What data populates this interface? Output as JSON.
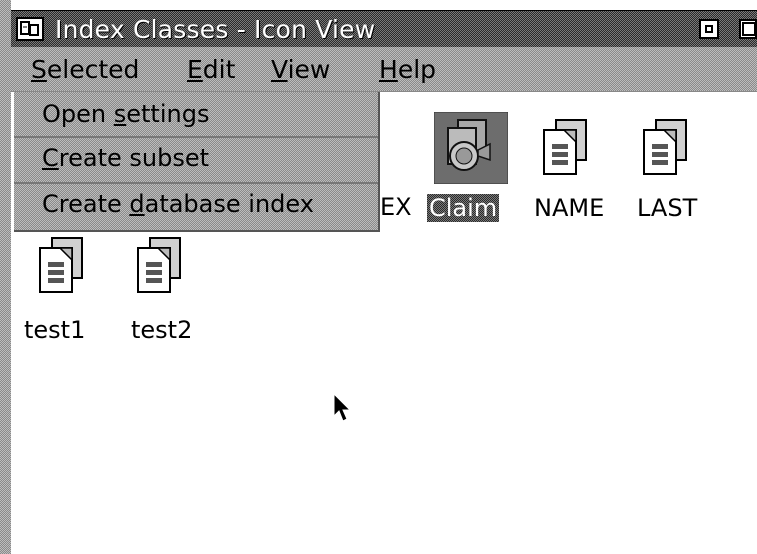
{
  "window": {
    "title": "Index Classes - Icon View"
  },
  "menubar": {
    "items": [
      {
        "label": "Selected",
        "mnemonic": "S",
        "rest": "elected"
      },
      {
        "label": "Edit",
        "mnemonic": "E",
        "rest": "dit"
      },
      {
        "label": "View",
        "mnemonic": "V",
        "rest": "iew"
      },
      {
        "label": "Help",
        "mnemonic": "H",
        "rest": "elp"
      }
    ]
  },
  "dropdown": {
    "items": [
      {
        "label": "Open settings",
        "before": "Open ",
        "mnemonic": "s",
        "after": "ettings"
      },
      {
        "label": "Create subset",
        "before": "",
        "mnemonic": "C",
        "after": "reate subset"
      },
      {
        "label": "Create database index",
        "before": "Create ",
        "mnemonic": "d",
        "after": "atabase index"
      }
    ]
  },
  "icons": {
    "partial_label": "EX",
    "items": [
      {
        "label": "Claim",
        "selected": true
      },
      {
        "label": "NAME",
        "selected": false
      },
      {
        "label": "LAST",
        "selected": false
      },
      {
        "label": "test1",
        "selected": false
      },
      {
        "label": "test2",
        "selected": false
      }
    ]
  },
  "colors": {
    "frame": "#bdbdbd",
    "text": "#000000",
    "background": "#ffffff"
  }
}
